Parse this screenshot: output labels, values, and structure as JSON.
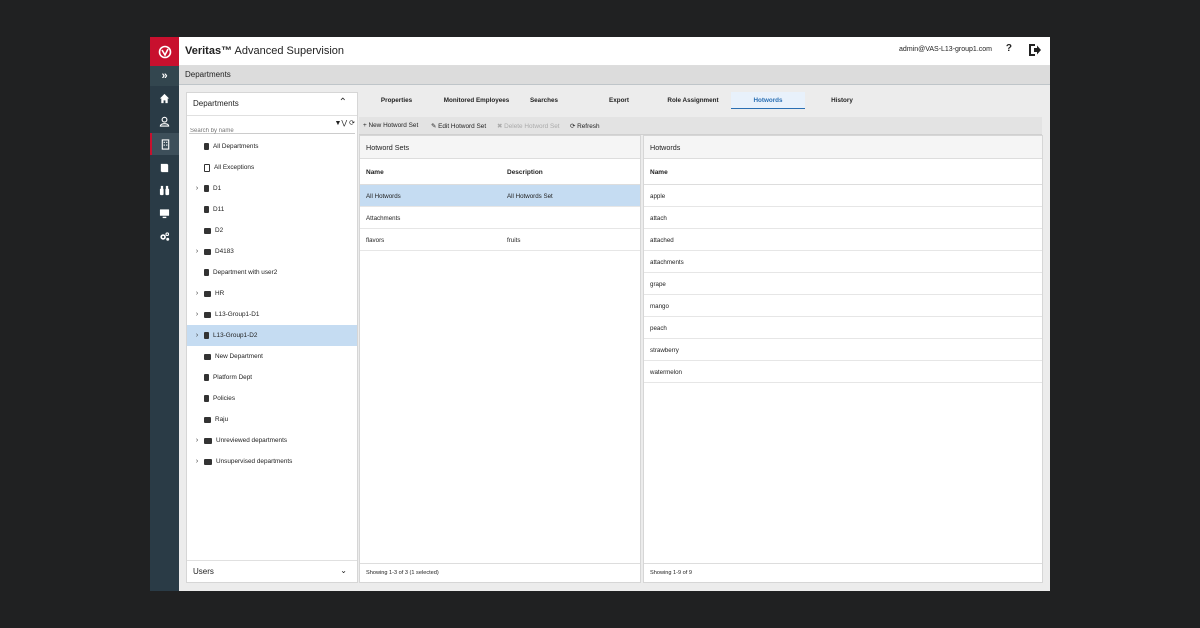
{
  "app": {
    "brand_name": "Veritas™",
    "product_name": "Advanced Supervision",
    "user": "admin@VAS-L13-group1.com",
    "help_label": "?",
    "expand_label": "»"
  },
  "breadcrumb": {
    "title": "Departments"
  },
  "rail": {
    "items": [
      {
        "icon": "home-icon"
      },
      {
        "icon": "user-icon"
      },
      {
        "icon": "building-icon",
        "active": true
      },
      {
        "icon": "book-icon"
      },
      {
        "icon": "binoculars-icon"
      },
      {
        "icon": "monitor-icon"
      },
      {
        "icon": "gears-icon"
      }
    ]
  },
  "left_panel": {
    "title": "Departments",
    "search_placeholder": "Search by name",
    "footer_title": "Users",
    "tree": [
      {
        "label": "All Departments",
        "icon": "building",
        "expandable": false
      },
      {
        "label": "All Exceptions",
        "icon": "exception",
        "expandable": false
      },
      {
        "label": "D1",
        "icon": "building",
        "expandable": true
      },
      {
        "label": "D11",
        "icon": "building",
        "expandable": false
      },
      {
        "label": "D2",
        "icon": "case",
        "expandable": false
      },
      {
        "label": "D4183",
        "icon": "case",
        "expandable": true
      },
      {
        "label": "Department with user2",
        "icon": "building",
        "expandable": false
      },
      {
        "label": "HR",
        "icon": "case",
        "expandable": true
      },
      {
        "label": "L13-Group1-D1",
        "icon": "case",
        "expandable": true
      },
      {
        "label": "L13-Group1-D2",
        "icon": "building",
        "expandable": true,
        "selected": true
      },
      {
        "label": "New Department",
        "icon": "case",
        "expandable": false
      },
      {
        "label": "Platform Dept",
        "icon": "building",
        "expandable": false
      },
      {
        "label": "Policies",
        "icon": "building",
        "expandable": false
      },
      {
        "label": "Raju",
        "icon": "case",
        "expandable": false
      },
      {
        "label": "Unreviewed departments",
        "icon": "folder",
        "expandable": true
      },
      {
        "label": "Unsupervised departments",
        "icon": "folder",
        "expandable": true
      }
    ]
  },
  "tabs": [
    {
      "label": "Properties"
    },
    {
      "label": "Monitored Employees"
    },
    {
      "label": "Searches"
    },
    {
      "label": "Export"
    },
    {
      "label": "Role Assignment"
    },
    {
      "label": "Hotwords",
      "active": true
    },
    {
      "label": "History"
    }
  ],
  "toolbar": {
    "new": "+ New Hotword Set",
    "edit": "Edit Hotword Set",
    "delete": "Delete Hotword Set",
    "refresh": "Refresh"
  },
  "hotword_sets": {
    "title": "Hotword Sets",
    "columns": [
      "Name",
      "Description"
    ],
    "rows": [
      {
        "name": "All Hotwords",
        "description": "All Hotwords Set",
        "selected": true
      },
      {
        "name": "Attachments",
        "description": ""
      },
      {
        "name": "flavors",
        "description": "fruits"
      }
    ],
    "footer": "Showing 1-3 of 3 (1 selected)"
  },
  "hotwords": {
    "title": "Hotwords",
    "column": "Name",
    "rows": [
      "apple",
      "attach",
      "attached",
      "attachments",
      "grape",
      "mango",
      "peach",
      "strawberry",
      "watermelon"
    ],
    "footer": "Showing 1-9 of 9"
  },
  "colors": {
    "accent_red": "#c8102e",
    "rail_bg": "#2a3b46",
    "selection_blue": "#c5dcf2",
    "tab_active": "#2a6fb3"
  }
}
